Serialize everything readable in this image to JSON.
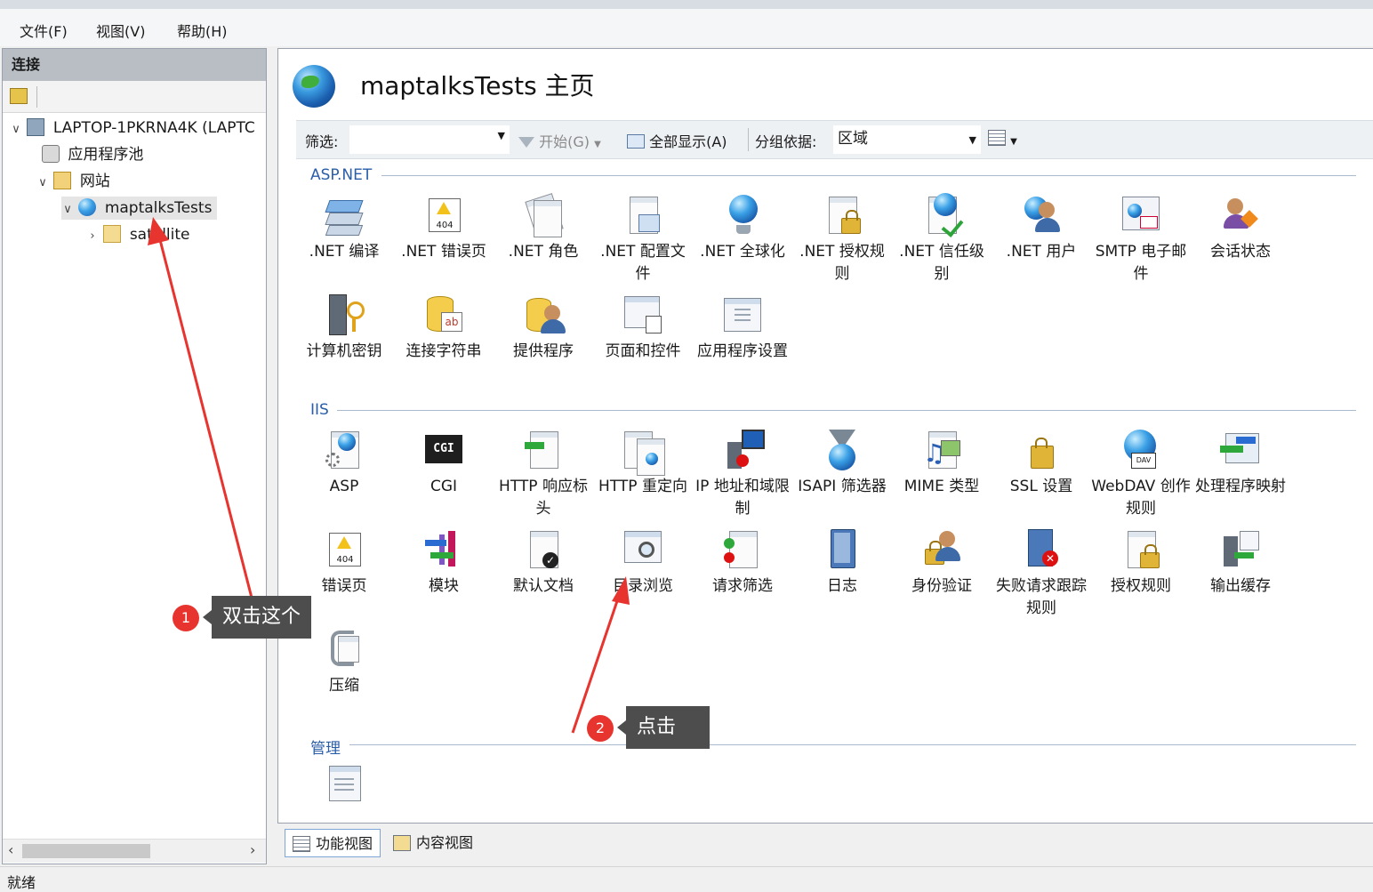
{
  "menu": [
    "文件(F)",
    "视图(V)",
    "帮助(H)"
  ],
  "left_pane": {
    "header": "连接",
    "tree": [
      {
        "label": "LAPTOP-1PKRNA4K (LAPTC",
        "level": 0,
        "expanded": true
      },
      {
        "label": "应用程序池",
        "level": 1
      },
      {
        "label": "网站",
        "level": 1,
        "expanded": true
      },
      {
        "label": "maptalksTests",
        "level": 2,
        "expanded": true,
        "selected": true
      },
      {
        "label": "satellite",
        "level": 3,
        "expanded": false
      }
    ]
  },
  "main": {
    "title": "maptalksTests 主页",
    "filter_label": "筛选:",
    "filter_value": "",
    "start_button": "开始(G)",
    "show_all_button": "全部显示(A)",
    "group_by_label": "分组依据:",
    "group_by_value": "区域",
    "sections": [
      {
        "name": "ASP.NET",
        "items": [
          ".NET 编译",
          ".NET 错误页",
          ".NET 角色",
          ".NET 配置文件",
          ".NET 全球化",
          ".NET 授权规则",
          ".NET 信任级别",
          ".NET 用户",
          "SMTP 电子邮件",
          "会话状态",
          "计算机密钥",
          "连接字符串",
          "提供程序",
          "页面和控件",
          "应用程序设置"
        ]
      },
      {
        "name": "IIS",
        "items": [
          "ASP",
          "CGI",
          "HTTP 响应标头",
          "HTTP 重定向",
          "IP 地址和域限制",
          "ISAPI 筛选器",
          "MIME 类型",
          "SSL 设置",
          "WebDAV 创作规则",
          "处理程序映射",
          "错误页",
          "模块",
          "默认文档",
          "目录浏览",
          "请求筛选",
          "日志",
          "身份验证",
          "失败请求跟踪规则",
          "授权规则",
          "输出缓存",
          "压缩"
        ]
      },
      {
        "name": "管理",
        "items": [
          ""
        ]
      }
    ]
  },
  "bottom_tabs": [
    "功能视图",
    "内容视图"
  ],
  "status": "就绪",
  "annotations": [
    {
      "number": "1",
      "text": "双击这个"
    },
    {
      "number": "2",
      "text": "点击"
    }
  ],
  "colors": {
    "accent": "#2b5ea8",
    "annotation": "#e8342f",
    "callout_bg": "#4d4d4d"
  }
}
